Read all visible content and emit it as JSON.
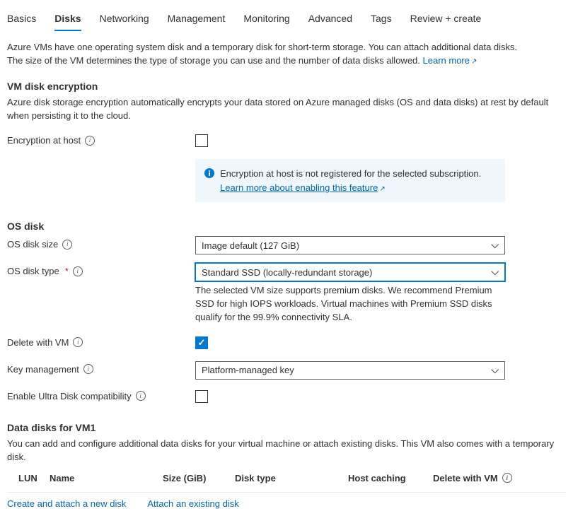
{
  "tabs": {
    "basics": "Basics",
    "disks": "Disks",
    "networking": "Networking",
    "management": "Management",
    "monitoring": "Monitoring",
    "advanced": "Advanced",
    "tags": "Tags",
    "review": "Review + create"
  },
  "intro": {
    "line1": "Azure VMs have one operating system disk and a temporary disk for short-term storage. You can attach additional data disks.",
    "line2": "The size of the VM determines the type of storage you can use and the number of data disks allowed.",
    "learn_more": "Learn more"
  },
  "encryption": {
    "header": "VM disk encryption",
    "desc": "Azure disk storage encryption automatically encrypts your data stored on Azure managed disks (OS and data disks) at rest by default when persisting it to the cloud.",
    "host_label": "Encryption at host",
    "banner_text": "Encryption at host is not registered for the selected subscription.",
    "banner_link": "Learn more about enabling this feature"
  },
  "osdisk": {
    "header": "OS disk",
    "size_label": "OS disk size",
    "size_value": "Image default (127 GiB)",
    "type_label": "OS disk type",
    "type_value": "Standard SSD (locally-redundant storage)",
    "type_helper": "The selected VM size supports premium disks. We recommend Premium SSD for high IOPS workloads. Virtual machines with Premium SSD disks qualify for the 99.9% connectivity SLA.",
    "delete_label": "Delete with VM",
    "keymgmt_label": "Key management",
    "keymgmt_value": "Platform-managed key",
    "ultra_label": "Enable Ultra Disk compatibility"
  },
  "datadisks": {
    "header": "Data disks for VM1",
    "desc": "You can add and configure additional data disks for your virtual machine or attach existing disks. This VM also comes with a temporary disk.",
    "columns": {
      "lun": "LUN",
      "name": "Name",
      "size": "Size (GiB)",
      "disk_type": "Disk type",
      "host_caching": "Host caching",
      "delete_with_vm": "Delete with VM"
    },
    "create_link": "Create and attach a new disk",
    "attach_link": "Attach an existing disk"
  }
}
